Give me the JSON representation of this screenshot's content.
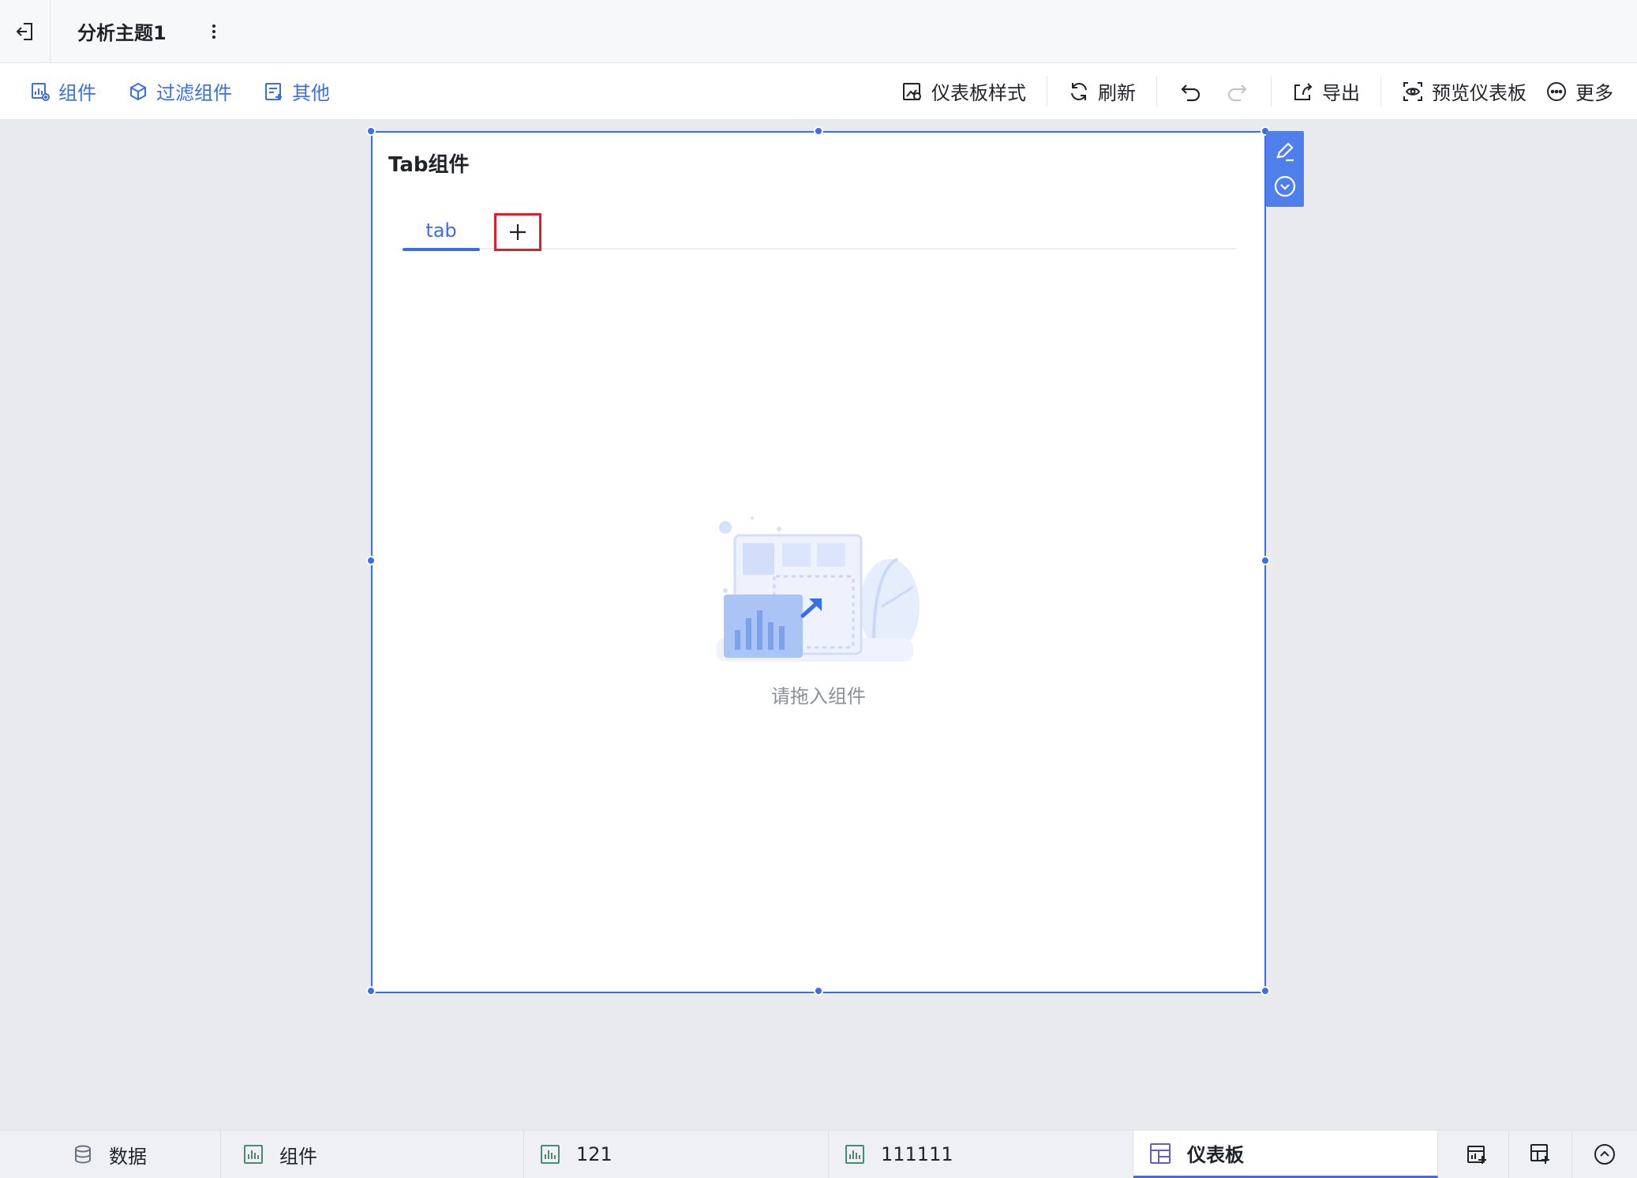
{
  "title": "分析主题1",
  "toolbar": {
    "left": [
      {
        "label": "组件",
        "icon": "component-icon"
      },
      {
        "label": "过滤组件",
        "icon": "filter-icon"
      },
      {
        "label": "其他",
        "icon": "other-icon"
      }
    ],
    "right": {
      "style_label": "仪表板样式",
      "refresh_label": "刷新",
      "export_label": "导出",
      "preview_label": "预览仪表板",
      "more_label": "更多"
    }
  },
  "widget": {
    "title": "Tab组件",
    "tabs": [
      {
        "label": "tab",
        "active": true
      }
    ],
    "add_tab_symbol": "+",
    "empty_text": "请拖入组件"
  },
  "bottom_tabs": [
    {
      "label": "数据",
      "icon": "database-icon"
    },
    {
      "label": "组件",
      "icon": "bar-chart-icon"
    },
    {
      "label": "121",
      "icon": "bar-chart-icon"
    },
    {
      "label": "111111",
      "icon": "bar-chart-icon"
    },
    {
      "label": "仪表板",
      "icon": "dashboard-icon",
      "active": true
    }
  ],
  "colors": {
    "accent": "#3a6ee8",
    "highlight_box": "#e11d2a",
    "canvas_bg": "#e8eaee"
  }
}
